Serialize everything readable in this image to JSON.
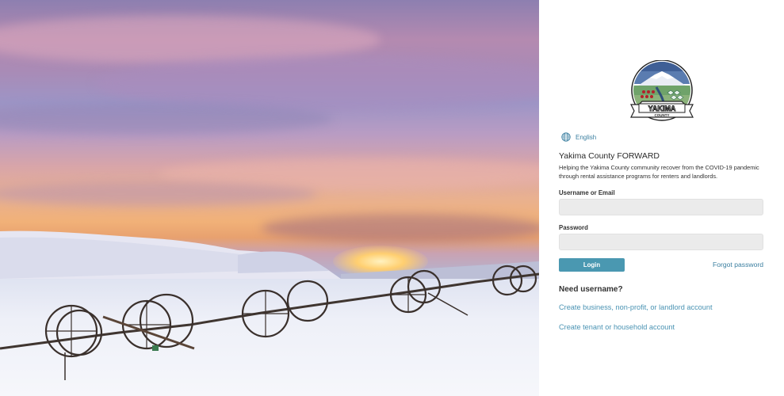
{
  "language": {
    "label": "English",
    "icon": "globe-icon"
  },
  "logo": {
    "name": "Yakima County seal logo",
    "text": "YAKIMA",
    "subtext": "COUNTY"
  },
  "app": {
    "title": "Yakima County FORWARD",
    "description": "Helping the Yakima County community recover from the COVID-19 pandemic through rental assistance programs for renters and landlords."
  },
  "form": {
    "username_label": "Username or Email",
    "username_value": "",
    "username_placeholder": "",
    "password_label": "Password",
    "password_value": "",
    "password_placeholder": "",
    "login_label": "Login",
    "forgot_label": "Forgot password"
  },
  "signup": {
    "heading": "Need username?",
    "business_link": "Create business, non-profit, or landlord account",
    "tenant_link": "Create tenant or household account"
  },
  "colors": {
    "accent": "#4a98b1",
    "link": "#3b7fa0",
    "field_bg": "#ebebeb"
  }
}
